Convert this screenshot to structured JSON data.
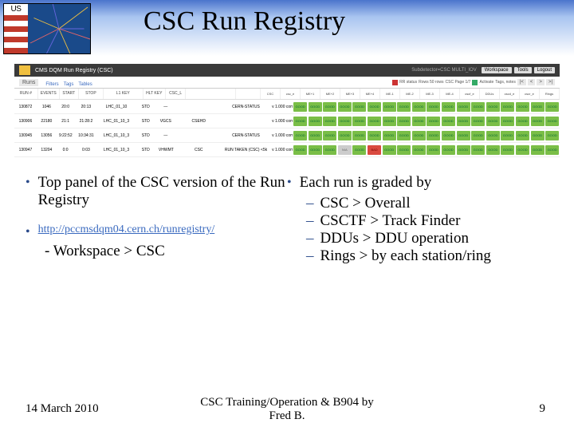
{
  "header": {
    "title": "CSC Run Registry",
    "logo_text": "US CMS"
  },
  "screenshot": {
    "app_title": "CMS DQM Run Registry (CSC)",
    "nav_right": [
      "Workspace",
      "Tools",
      "Logout"
    ],
    "filterbar": {
      "main": "Runs",
      "links": [
        "Filters",
        "Tags",
        "Tables"
      ],
      "legend": [
        "RR status",
        "Rows 50 rows",
        "CSC Page 1/7",
        "Activate",
        "Tags, notes"
      ],
      "nav": [
        "|<",
        "<",
        ">",
        ">|"
      ]
    },
    "columns_left": [
      "RUN #",
      "EVENTS",
      "START",
      "STOP",
      "L1 KEY",
      "HLT KEY",
      "CSC_L"
    ],
    "columns_right": [
      "CSC",
      "csc_e",
      "ME+1",
      "ME+2",
      "ME+3",
      "ME+4",
      "ME-1",
      "ME-2",
      "ME-3",
      "ME-4",
      "cscf_e",
      "DDUs",
      "cscd_e",
      "cscr_e",
      "Rings"
    ],
    "rows": [
      {
        "cells": [
          "130872",
          "1046",
          "20:0",
          "20:13",
          "LHC_01_10",
          "STD",
          "—",
          "",
          "CERN-STATUS",
          "v 1.000 common"
        ],
        "status": [
          "g",
          "g",
          "g",
          "g",
          "g",
          "g",
          "g",
          "g",
          "g",
          "g",
          "g",
          "g",
          "g",
          "g",
          "g",
          "g",
          "g",
          "g"
        ]
      },
      {
        "cells": [
          "130906",
          "22180",
          "21:1",
          "21:28:2",
          "LHC_01_10_3",
          "STD",
          "VGCS",
          "CSEHD",
          "",
          "v 1.000 common"
        ],
        "status": [
          "g",
          "g",
          "g",
          "g",
          "g",
          "g",
          "g",
          "g",
          "g",
          "g",
          "g",
          "g",
          "g",
          "g",
          "g",
          "g",
          "g",
          "g"
        ]
      },
      {
        "cells": [
          "130945",
          "13056",
          "9:22:52",
          "10:34:31",
          "LHC_01_10_3",
          "STD",
          "—",
          "",
          "CERN-STATUS",
          "v 1.000 common"
        ],
        "status": [
          "g",
          "g",
          "g",
          "g",
          "g",
          "g",
          "g",
          "g",
          "g",
          "g",
          "g",
          "g",
          "g",
          "g",
          "g",
          "g",
          "g",
          "g"
        ]
      },
      {
        "cells": [
          "130947",
          "13204",
          "0:0",
          "0:03",
          "LHC_01_10_3",
          "STD",
          "VHWMT",
          "CSC",
          "RUN TAKEN (CSC) <5k",
          "v 1.000 common"
        ],
        "status": [
          "g",
          "g",
          "g",
          "gry",
          "g",
          "r",
          "g",
          "g",
          "g",
          "g",
          "g",
          "g",
          "g",
          "g",
          "g",
          "g",
          "g",
          "g"
        ]
      }
    ]
  },
  "bullets": {
    "left_main": "Top panel of the CSC version of the Run Registry",
    "left_link": "http://pccmsdqm04.cern.ch/runregistry/",
    "left_sub": "- Workspace > CSC",
    "right_main": "Each run is graded by",
    "right_subs": [
      "CSC > Overall",
      "CSCTF > Track Finder",
      "DDUs > DDU operation",
      "Rings > by each station/ring"
    ]
  },
  "footer": {
    "date": "14 March 2010",
    "center1": "CSC Training/Operation & B904 by",
    "center2": "Fred B.",
    "page": "9"
  }
}
